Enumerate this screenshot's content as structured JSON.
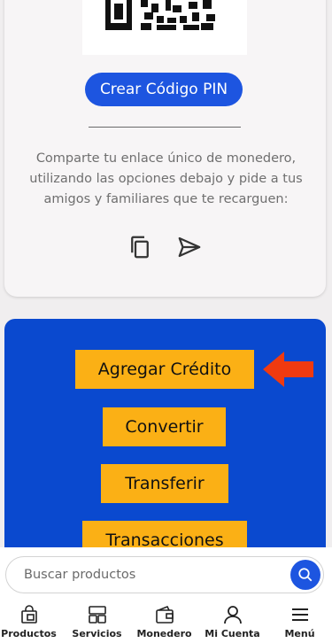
{
  "pin_button": {
    "label": "Crear Código PIN"
  },
  "share": {
    "lines": [
      "Comparte tu enlace único de monedero,",
      "utilizando las opciones debajo y pide a tus",
      "amigos y familiares que te recarguen:"
    ],
    "icons": [
      "copy-icon",
      "send-icon"
    ]
  },
  "actions": {
    "add_credit": "Agregar Crédito",
    "convert": "Convertir",
    "transfer": "Transferir",
    "transactions": "Transacciones"
  },
  "search": {
    "placeholder": "Buscar productos"
  },
  "nav": [
    {
      "label": "Productos",
      "icon": "shopping-bag-icon"
    },
    {
      "label": "Servicios",
      "icon": "grid-icon"
    },
    {
      "label": "Monedero",
      "icon": "wallet-icon"
    },
    {
      "label": "Mi Cuenta",
      "icon": "user-icon"
    },
    {
      "label": "Menú",
      "icon": "menu-icon"
    }
  ],
  "colors": {
    "primary_blue": "#1d55e0",
    "panel_blue": "#0a49cf",
    "button_yellow": "#fbb015",
    "arrow_red": "#f03a10"
  }
}
